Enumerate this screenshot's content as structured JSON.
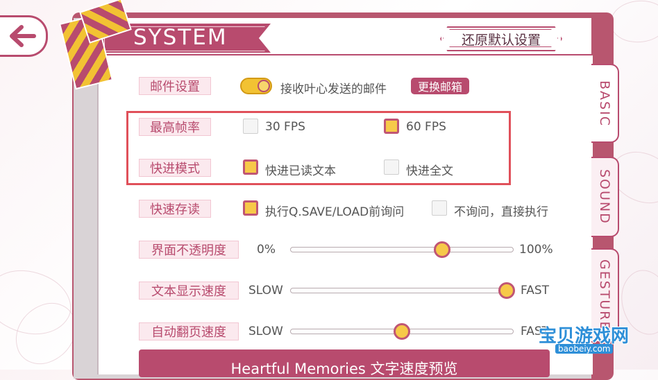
{
  "header": {
    "title": "SYSTEM",
    "reset_label": "还原默认设置"
  },
  "tabs": [
    {
      "label": "BASIC",
      "active": true
    },
    {
      "label": "SOUND",
      "active": false
    },
    {
      "label": "GESTURE",
      "active": false
    }
  ],
  "settings": {
    "mail": {
      "label": "邮件设置",
      "toggle_on": true,
      "toggle_text": "接收叶心发送的邮件",
      "change_button": "更换邮箱"
    },
    "max_fps": {
      "label": "最高帧率",
      "options": [
        {
          "label": "30 FPS",
          "checked": false
        },
        {
          "label": "60 FPS",
          "checked": true
        }
      ]
    },
    "skip_mode": {
      "label": "快进模式",
      "options": [
        {
          "label": "快进已读文本",
          "checked": true
        },
        {
          "label": "快进全文",
          "checked": false
        }
      ]
    },
    "quick_save": {
      "label": "快速存读",
      "options": [
        {
          "label": "执行Q.SAVE/LOAD前询问",
          "checked": true
        },
        {
          "label": "不询问，直接执行",
          "checked": false
        }
      ]
    },
    "opacity": {
      "label": "界面不透明度",
      "min_label": "0%",
      "max_label": "100%",
      "value": 0.68
    },
    "text_speed": {
      "label": "文本显示速度",
      "min_label": "SLOW",
      "max_label": "FAST",
      "value": 0.97
    },
    "auto_speed": {
      "label": "自动翻页速度",
      "min_label": "SLOW",
      "max_label": "FAST",
      "value": 0.5
    }
  },
  "preview_label": "Heartful Memories 文字速度预览",
  "watermark": {
    "text": "宝贝游戏网",
    "url": "baobeiy.com"
  },
  "colors": {
    "accent": "#b84b6e",
    "checkbox_fill": "#f7c949",
    "highlight": "#e0505a",
    "label_bg": "#fbe9ee"
  }
}
